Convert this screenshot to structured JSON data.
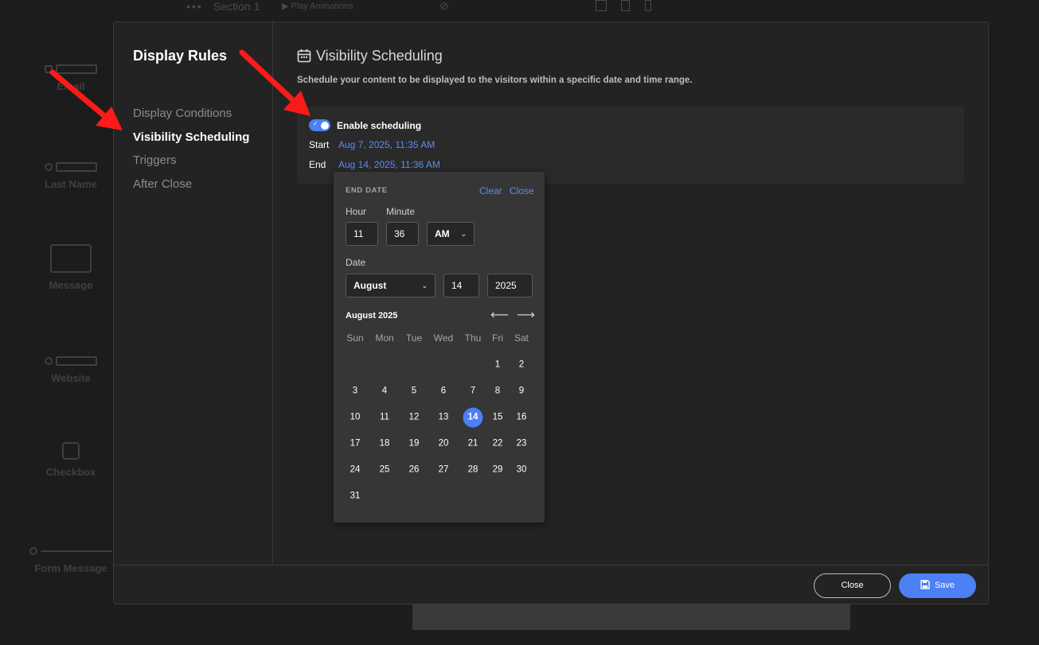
{
  "background": {
    "topbar": {
      "section_label": "Section 1",
      "play_label": "Play Animations"
    },
    "sidebar_fields": [
      "Email",
      "Last Name",
      "Message",
      "Website",
      "Checkbox",
      "Form Message"
    ]
  },
  "modal": {
    "title": "Display Rules",
    "nav": [
      {
        "label": "Display Conditions",
        "active": false
      },
      {
        "label": "Visibility Scheduling",
        "active": true
      },
      {
        "label": "Triggers",
        "active": false
      },
      {
        "label": "After Close",
        "active": false
      }
    ],
    "section": {
      "title": "Visibility Scheduling",
      "icon": "calendar-icon",
      "description": "Schedule your content to be displayed to the visitors within a specific date and time range.",
      "enable_label": "Enable scheduling",
      "enabled": true,
      "start_label": "Start",
      "start_value": "Aug 7, 2025, 11:35 AM",
      "end_label": "End",
      "end_value": "Aug 14, 2025, 11:36 AM"
    },
    "picker": {
      "header": "END DATE",
      "clear_label": "Clear",
      "close_label": "Close",
      "hour_label": "Hour",
      "minute_label": "Minute",
      "hour": "11",
      "minute": "36",
      "ampm": "AM",
      "date_label": "Date",
      "month": "August",
      "day": "14",
      "year": "2025",
      "calendar_title": "August 2025",
      "weekdays": [
        "Sun",
        "Mon",
        "Tue",
        "Wed",
        "Thu",
        "Fri",
        "Sat"
      ],
      "first_weekday_index": 5,
      "days_in_month": 31,
      "selected_day": 14,
      "prev_icon": "arrow-left-icon",
      "next_icon": "arrow-right-icon"
    },
    "footer": {
      "close_label": "Close",
      "save_label": "Save"
    }
  },
  "colors": {
    "accent": "#4d7ff5",
    "annotation_arrow": "#ff1a1a"
  }
}
